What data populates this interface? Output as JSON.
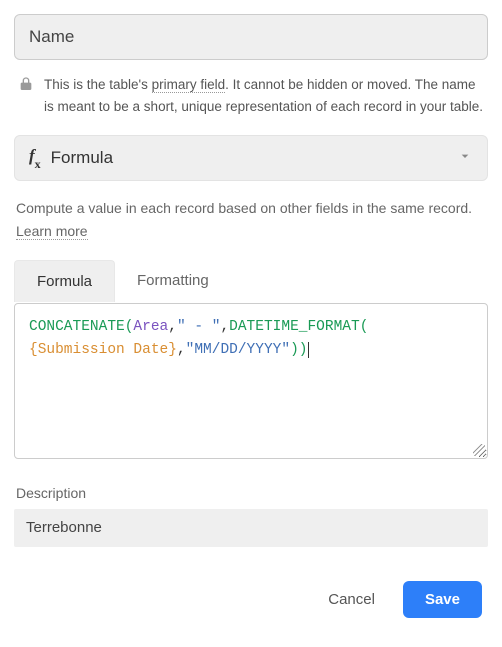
{
  "name_field": {
    "value": "Name"
  },
  "primary_helper": {
    "prefix": "This is the table's ",
    "linked": "primary field",
    "suffix": ". It cannot be hidden or moved. The name is meant to be a short, unique representation of each record in your table."
  },
  "type_selector": {
    "label": "Formula"
  },
  "type_description": {
    "text": "Compute a value in each record based on other fields in the same record. ",
    "learn_more": "Learn more"
  },
  "tabs": {
    "formula": "Formula",
    "formatting": "Formatting"
  },
  "formula_tokens": {
    "fn_concat": "CONCATENATE",
    "lp1": "(",
    "ref_area": "Area",
    "comma1": ",",
    "str_sep": "\" - \"",
    "comma2": ",",
    "fn_dtf": "DATETIME_FORMAT",
    "lp2": "(",
    "ref_sub_open": "{",
    "ref_sub_name": "Submission Date",
    "ref_sub_close": "}",
    "comma3": ",",
    "str_fmt": "\"MM/DD/YYYY\"",
    "rp2": ")",
    "rp1": ")"
  },
  "description": {
    "label": "Description",
    "value": "Terrebonne"
  },
  "footer": {
    "cancel": "Cancel",
    "save": "Save"
  }
}
